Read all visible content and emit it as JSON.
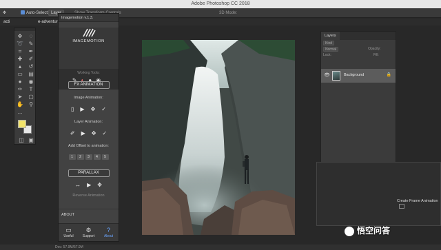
{
  "window": {
    "title": "Adobe Photoshop CC 2018"
  },
  "options_bar": {
    "auto_select_label": "Auto-Select:",
    "auto_select_value": "Layer",
    "transform_controls_label": "Show Transform Controls",
    "mode_3d_label": "3D Mode:"
  },
  "doc_tabs": [
    {
      "label": "acti"
    },
    {
      "label": "e-adventure"
    }
  ],
  "imagemotion": {
    "title": "Imagemotion v.1.3.",
    "brand": "IMAGEMOTION",
    "working_tools_label": "Working Tools:",
    "fx_animation_label": "FX ANIMATION",
    "image_animation_label": "Image Animation:",
    "layer_animation_label": "Layer Animation:",
    "add_offset_label": "Add Offset to animation:",
    "offset_numbers": [
      "1",
      "2",
      "3",
      "4",
      "5"
    ],
    "parallax_label": "PARALLAX",
    "reverse_animation_label": "Reverse Animation",
    "about_label": "ABOUT",
    "nav": [
      {
        "label": "Useful",
        "icon": "monitor-icon"
      },
      {
        "label": "Support",
        "icon": "gear-icon"
      },
      {
        "label": "About",
        "icon": "question-icon"
      }
    ]
  },
  "layers_panel": {
    "tab_label": "Layers",
    "kind_label": "Kind",
    "blend_mode": "Normal",
    "opacity_label": "Opacity:",
    "lock_label": "Lock:",
    "fill_label": "Fill:",
    "layer_name": "Background"
  },
  "timeline": {
    "create_button_label": "Create Frame Animation"
  },
  "status_bar": {
    "doc_label": "Doc: 57.9M/57.9M"
  },
  "watermark": {
    "text": "悟空问答"
  },
  "colors": {
    "foreground_swatch": "#f3e46a",
    "background_swatch": "#e8e8e8",
    "accent": "#6aa6ff"
  }
}
